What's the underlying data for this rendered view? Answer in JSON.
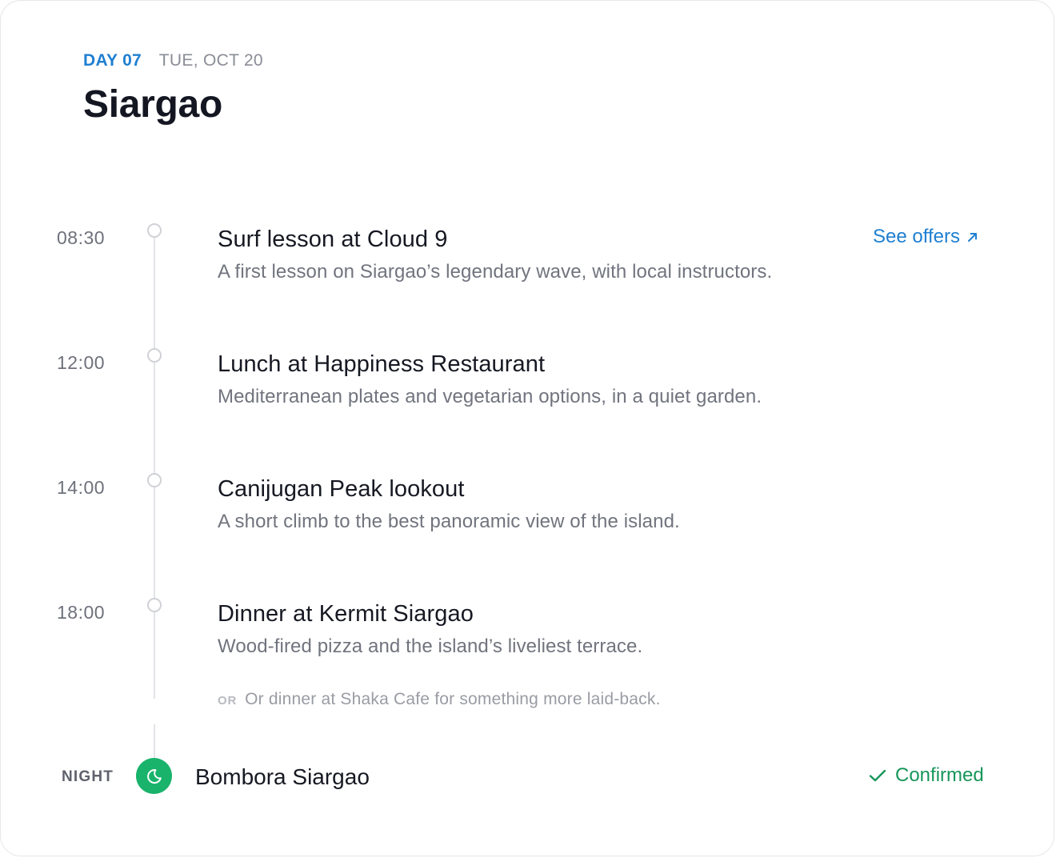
{
  "header": {
    "day": "DAY 07",
    "date": "TUE, OCT 20",
    "title": "Siargao"
  },
  "events": [
    {
      "time": "08:30",
      "title": "Surf lesson at Cloud 9",
      "description": "A first lesson on Siargao’s legendary wave, with local instructors.",
      "action": "See offers"
    },
    {
      "time": "12:00",
      "title": "Lunch at Happiness Restaurant",
      "description": "Mediterranean plates and vegetarian options, in a quiet garden."
    },
    {
      "time": "14:00",
      "title": "Canijugan Peak lookout",
      "description": "A short climb to the best panoramic view of the island."
    },
    {
      "time": "18:00",
      "title": "Dinner at Kermit Siargao",
      "description": "Wood-fired pizza and the island’s liveliest terrace.",
      "alternative_prefix": "OR",
      "alternative": "Or dinner at Shaka Cafe for something more laid-back."
    }
  ],
  "night": {
    "label": "NIGHT",
    "icon": "moon-icon",
    "title": "Bombora Siargao",
    "status": "Confirmed",
    "status_icon": "check-icon"
  },
  "colors": {
    "accent": "#1f7fd1",
    "success": "#17965a",
    "night_badge": "#19b36b"
  }
}
